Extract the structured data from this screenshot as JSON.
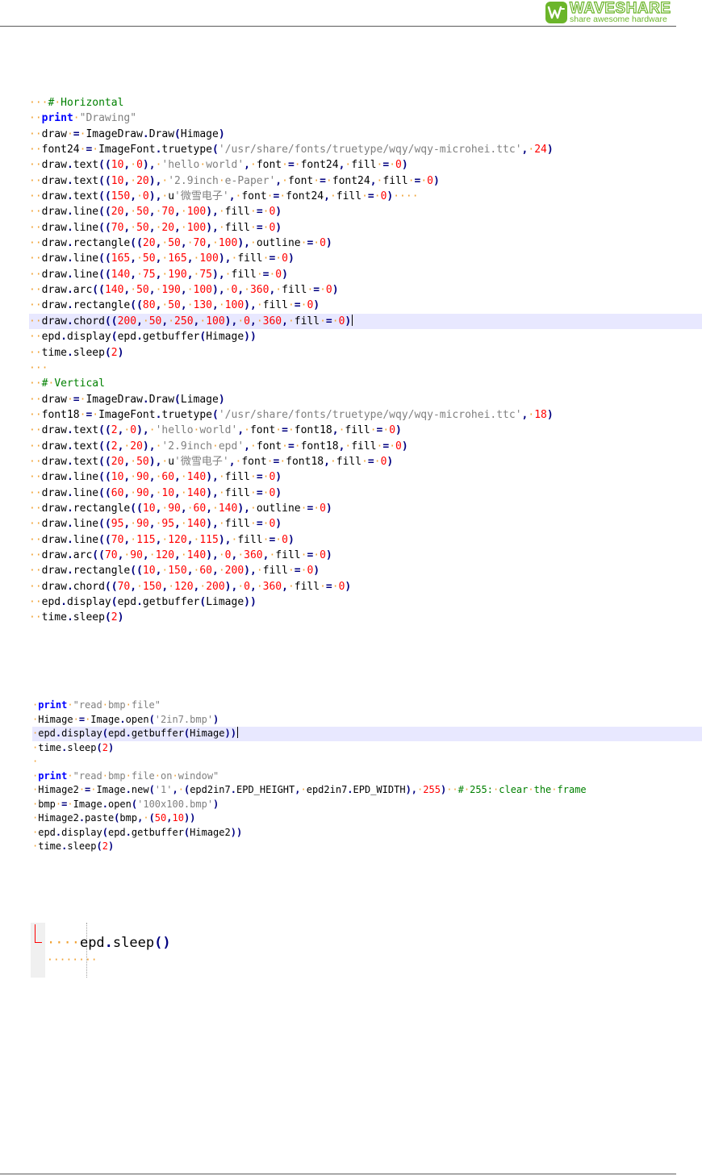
{
  "brand": {
    "name": "WAVESHARE",
    "tagline": "share awesome hardware",
    "color": "#6bb52a"
  },
  "colors": {
    "keyword": "#0000ff",
    "number": "#ff0000",
    "string": "#808080",
    "comment": "#008000",
    "operator": "#000080",
    "whitespace_marker": "#f0a030",
    "highlight": "#e8e8ff"
  },
  "code_block_1": [
    "···#·Horizontal",
    "··print·\"Drawing\"",
    "··draw·=·ImageDraw.Draw(Himage)",
    "··font24·=·ImageFont.truetype('/usr/share/fonts/truetype/wqy/wqy-microhei.ttc',·24)",
    "··draw.text((10,·0),·'hello·world',·font·=·font24,·fill·=·0)",
    "··draw.text((10,·20),·'2.9inch·e-Paper',·font·=·font24,·fill·=·0)",
    "··draw.text((150,·0),·u'微雪电子',·font·=·font24,·fill·=·0)····",
    "··draw.line((20,·50,·70,·100),·fill·=·0)",
    "··draw.line((70,·50,·20,·100),·fill·=·0)",
    "··draw.rectangle((20,·50,·70,·100),·outline·=·0)",
    "··draw.line((165,·50,·165,·100),·fill·=·0)",
    "··draw.line((140,·75,·190,·75),·fill·=·0)",
    "··draw.arc((140,·50,·190,·100),·0,·360,·fill·=·0)",
    "··draw.rectangle((80,·50,·130,·100),·fill·=·0)",
    "··draw.chord((200,·50,·250,·100),·0,·360,·fill·=·0)",
    "··epd.display(epd.getbuffer(Himage))",
    "··time.sleep(2)",
    "···",
    "··#·Vertical",
    "··draw·=·ImageDraw.Draw(Limage)",
    "··font18·=·ImageFont.truetype('/usr/share/fonts/truetype/wqy/wqy-microhei.ttc',·18)",
    "··draw.text((2,·0),·'hello·world',·font·=·font18,·fill·=·0)",
    "··draw.text((2,·20),·'2.9inch·epd',·font·=·font18,·fill·=·0)",
    "··draw.text((20,·50),·u'微雪电子',·font·=·font18,·fill·=·0)",
    "··draw.line((10,·90,·60,·140),·fill·=·0)",
    "··draw.line((60,·90,·10,·140),·fill·=·0)",
    "··draw.rectangle((10,·90,·60,·140),·outline·=·0)",
    "··draw.line((95,·90,·95,·140),·fill·=·0)",
    "··draw.line((70,·115,·120,·115),·fill·=·0)",
    "··draw.arc((70,·90,·120,·140),·0,·360,·fill·=·0)",
    "··draw.rectangle((10,·150,·60,·200),·fill·=·0)",
    "··draw.chord((70,·150,·120,·200),·0,·360,·fill·=·0)",
    "··epd.display(epd.getbuffer(Limage))",
    "··time.sleep(2)"
  ],
  "code_block_2": [
    "·print·\"read·bmp·file\"",
    "·Himage·=·Image.open('2in7.bmp')",
    "·epd.display(epd.getbuffer(Himage))",
    "·time.sleep(2)",
    "·",
    "·print·\"read·bmp·file·on·window\"",
    "·Himage2·=·Image.new('1',·(epd2in7.EPD_HEIGHT,·epd2in7.EPD_WIDTH),·255)··#·255:·clear·the·frame",
    "·bmp·=·Image.open('100x100.bmp')",
    "·Himage2.paste(bmp,·(50,10))",
    "·epd.display(epd.getbuffer(Himage2))",
    "·time.sleep(2)"
  ],
  "code_block_3": [
    "····epd.sleep()",
    "········"
  ]
}
